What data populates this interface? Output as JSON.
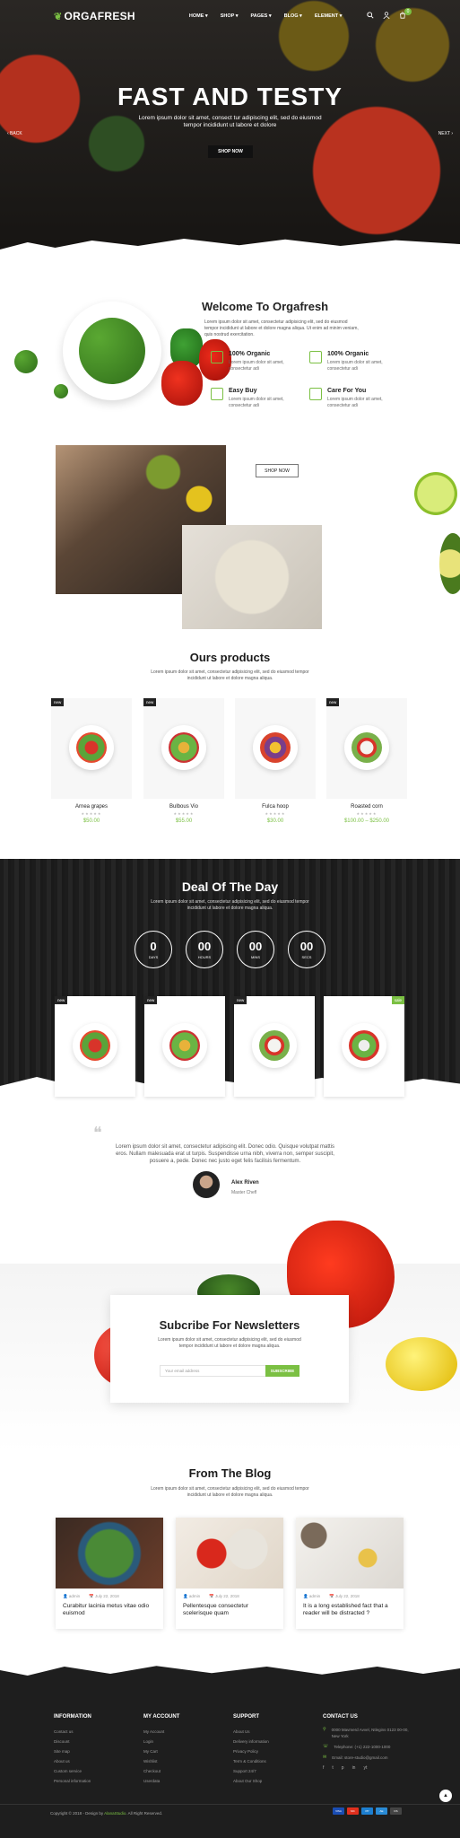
{
  "header": {
    "logo_text": "ORGAFRESH",
    "nav": [
      "HOME ▾",
      "SHOP ▾",
      "PAGES ▾",
      "BLOG ▾",
      "ELEMENT ▾"
    ],
    "cart_count": "0"
  },
  "hero": {
    "title": "FAST AND TESTY",
    "subtitle": "Lorem ipsum dolor sit amet, consect tur adipiscing elit, sed do eiusmod tempor incididunt ut labore et dolore",
    "button": "SHOP NOW",
    "prev": "‹ BACK",
    "next": "NEXT ›"
  },
  "welcome": {
    "title": "Welcome To Orgafresh",
    "text": "Lorem ipsum dolor sit amet, consectetur adipisicing elit, sed do eiusmod tempor incididunt ut labore et dolore magna aliqua. Ut enim ad minim veniam, quis nostrud exercitation.",
    "features": [
      {
        "title": "100% Organic",
        "desc": "Lorem ipsum dolor sit amet, consectetur adi"
      },
      {
        "title": "100% Organic",
        "desc": "Lorem ipsum dolor sit amet, consectetur adi"
      },
      {
        "title": "Easy Buy",
        "desc": "Lorem ipsum dolor sit amet, consectetur adi"
      },
      {
        "title": "Care For You",
        "desc": "Lorem ipsum dolor sit amet, consectetur adi"
      }
    ],
    "shop_button": "SHOP NOW"
  },
  "products": {
    "title": "Ours products",
    "subtitle": "Lorem ipsum dolor sit amet, consectetur adipisicing elit, sed do eiusmod tempor incididunt ut labore et dolore magna aliqua.",
    "items": [
      {
        "badge": "new",
        "name": "Arnea grapes",
        "stars": "★★★★★",
        "price": "$50.00"
      },
      {
        "badge": "new",
        "name": "Bulbous Vio",
        "stars": "★★★★★",
        "price": "$55.00"
      },
      {
        "badge": "",
        "name": "Fulca hoop",
        "stars": "★★★★★",
        "price": "$30.00"
      },
      {
        "badge": "new",
        "name": "Roasted corn",
        "stars": "★★★★★",
        "price": "$100.00 – $250.00"
      }
    ]
  },
  "deal": {
    "title": "Deal Of The Day",
    "subtitle": "Lorem ipsum dolor sit amet, consectetur adipisicing elit, sed do eiusmod tempor incididunt ut labore et dolore magna aliqua.",
    "countdown": [
      {
        "value": "0",
        "label": "DAYS"
      },
      {
        "value": "00",
        "label": "HOURS"
      },
      {
        "value": "00",
        "label": "MINS"
      },
      {
        "value": "00",
        "label": "SECS"
      }
    ],
    "badges": [
      "new",
      "new",
      "new",
      "sale"
    ]
  },
  "testimonial": {
    "quote_mark": "❝",
    "text": "Lorem ipsum dolor sit amet, consectetur adipiscing elit. Donec odio. Quisque volutpat mattis eros. Nullam malesuada erat ut turpis. Suspendisse urna nibh, viverra non, semper suscipit, posuere a, pede. Donec nec justo eget felis facilisis fermentum.",
    "name": "Alex Riven",
    "role": "Master Chefl"
  },
  "newsletter": {
    "title": "Subcribe For Newsletters",
    "subtitle": "Lorem ipsum dolor sit amet, consectetur adipisicing elit, sed do eiusmod tempor incididunt ut labore et dolore magna aliqua.",
    "placeholder": "Your email address",
    "button": "SUBSCRIBE"
  },
  "blog": {
    "title": "From The Blog",
    "subtitle": "Lorem ipsum dolor sit amet, consectetur adipisicing elit, sed do eiusmod tempor incididunt ut labore et dolore magna aliqua.",
    "posts": [
      {
        "author": "admin",
        "date": "July 22, 2018",
        "title": "Curabitur lacinia metus vitae odio euismod"
      },
      {
        "author": "admin",
        "date": "July 22, 2018",
        "title": "Pellentesque consectetur scelerisque quam"
      },
      {
        "author": "admin",
        "date": "July 22, 2018",
        "title": "It is a long established fact that a reader will be distracted ?"
      }
    ]
  },
  "footer": {
    "information": {
      "title": "INFORMATION",
      "links": [
        "Contact us",
        "Discount",
        "Site map",
        "About us",
        "Custom service",
        "Personal information"
      ]
    },
    "account": {
      "title": "MY ACCOUNT",
      "links": [
        "My Account",
        "Login",
        "My Cart",
        "Wishlist",
        "Checkout",
        "Userdata"
      ]
    },
    "support": {
      "title": "SUPPORT",
      "links": [
        "About Us",
        "Delivery information",
        "Privacy Policy",
        "Term & Conditions",
        "Support 24/7",
        "About Our Shop"
      ]
    },
    "contact": {
      "title": "CONTACT US",
      "address": "0000 Mavmerd Avvel, Ntlegins 0123 00-00, New York",
      "phone": "Telephone: (+1) 222-1000-1000",
      "email": "Email: store-studio@gmail.com",
      "socials": [
        "f",
        "t",
        "p",
        "in",
        "yt"
      ]
    },
    "copyright_prefix": "Copyright © 2018 - Design by ",
    "copyright_brand": "AlanaStudio",
    "copyright_suffix": ". All Right Reserved.",
    "payments": [
      "VISA",
      "MC",
      "PP",
      "AE",
      "DS"
    ],
    "to_top": "▲"
  }
}
